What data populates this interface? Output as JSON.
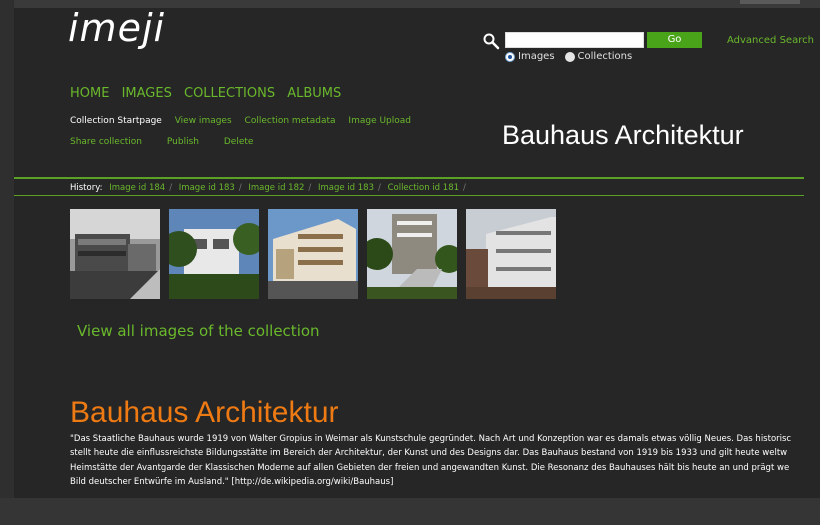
{
  "app": {
    "logo_text": "imeji"
  },
  "search": {
    "placeholder": "",
    "value": "",
    "go_label": "Go",
    "advanced_label": "Advanced Search",
    "options": [
      {
        "label": "Images",
        "selected": true
      },
      {
        "label": "Collections",
        "selected": false
      }
    ]
  },
  "nav": {
    "items": [
      "HOME",
      "IMAGES",
      "COLLECTIONS",
      "ALBUMS"
    ]
  },
  "subnav": {
    "row1": [
      "Collection Startpage",
      "View images",
      "Collection metadata",
      "Image Upload"
    ],
    "row2": [
      "Share collection",
      "Publish",
      "Delete"
    ]
  },
  "header": {
    "title": "Bauhaus Architektur"
  },
  "history": {
    "label": "History:",
    "items": [
      "Image id 184",
      "Image id 183",
      "Image id 182",
      "Image id 183",
      "Collection id 181"
    ],
    "separator": "/"
  },
  "thumbnails": [
    {
      "icon": "building-photo-bw"
    },
    {
      "icon": "building-photo-white-trees"
    },
    {
      "icon": "building-photo-apartment"
    },
    {
      "icon": "building-photo-stairs"
    },
    {
      "icon": "building-photo-balconies"
    }
  ],
  "collection": {
    "view_all_label": "View all images of the collection",
    "title": "Bauhaus Architektur",
    "description_lines": [
      "\"Das Staatliche Bauhaus wurde 1919 von Walter Gropius in Weimar als Kunstschule gegründet. Nach Art und Konzeption war es damals etwas völlig Neues. Das historisc",
      "stellt heute die einflussreichste Bildungsstätte im Bereich der Architektur, der Kunst und des Designs dar. Das Bauhaus bestand von 1919 bis 1933 und gilt heute weltw",
      "Heimstätte der Avantgarde der Klassischen Moderne auf allen Gebieten der freien und angewandten Kunst. Die Resonanz des Bauhauses hält bis heute an und prägt we",
      "Bild deutscher Entwürfe im Ausland.\" [http://de.wikipedia.org/wiki/Bauhaus]"
    ]
  },
  "colors": {
    "background": "#262626",
    "accent_green": "#6ab82c",
    "title_orange": "#ee7a13",
    "button_green": "#4aa41a"
  }
}
